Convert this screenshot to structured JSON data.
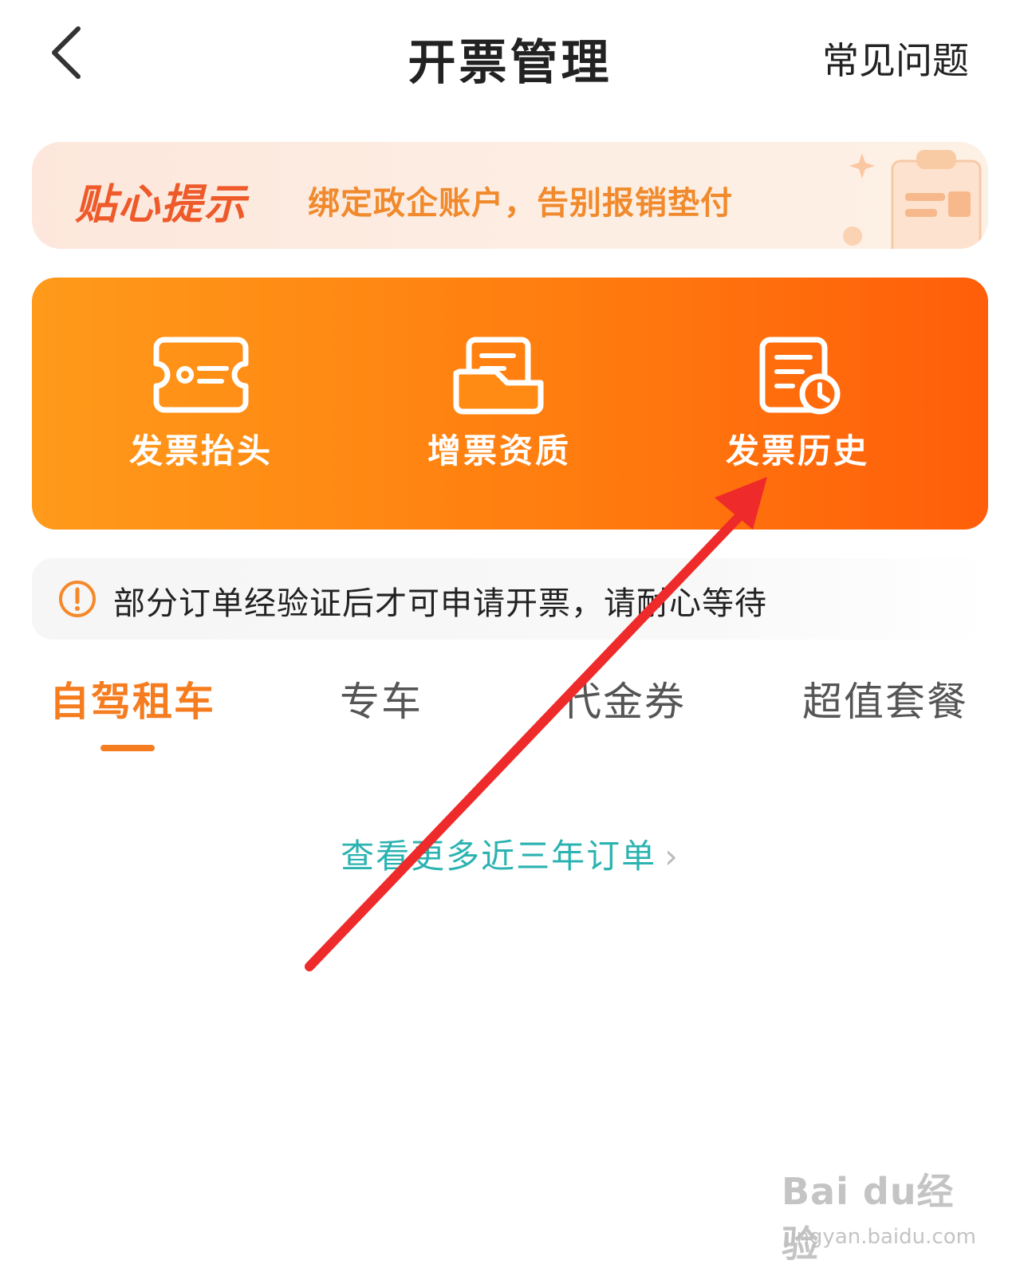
{
  "header": {
    "title": "开票管理",
    "faq_label": "常见问题"
  },
  "tip": {
    "title": "贴心提示",
    "text": "绑定政企账户，告别报销垫付"
  },
  "actions": [
    {
      "label": "发票抬头",
      "icon": "invoice-title-icon"
    },
    {
      "label": "增票资质",
      "icon": "qualification-icon"
    },
    {
      "label": "发票历史",
      "icon": "invoice-history-icon"
    }
  ],
  "notice": {
    "text": "部分订单经验证后才可申请开票，请耐心等待"
  },
  "tabs": [
    "自驾租车",
    "专车",
    "代金券",
    "超值套餐"
  ],
  "active_tab": "自驾租车",
  "more_link": "查看更多近三年订单",
  "watermark": {
    "main": "Bai du经验",
    "sub": "jingyan.baidu.com"
  },
  "colors": {
    "accent": "#f57c1f",
    "card_start": "#ff9a1a",
    "card_end": "#ff5e0a",
    "link": "#2bb3b1",
    "arrow": "#ee2a2a"
  }
}
